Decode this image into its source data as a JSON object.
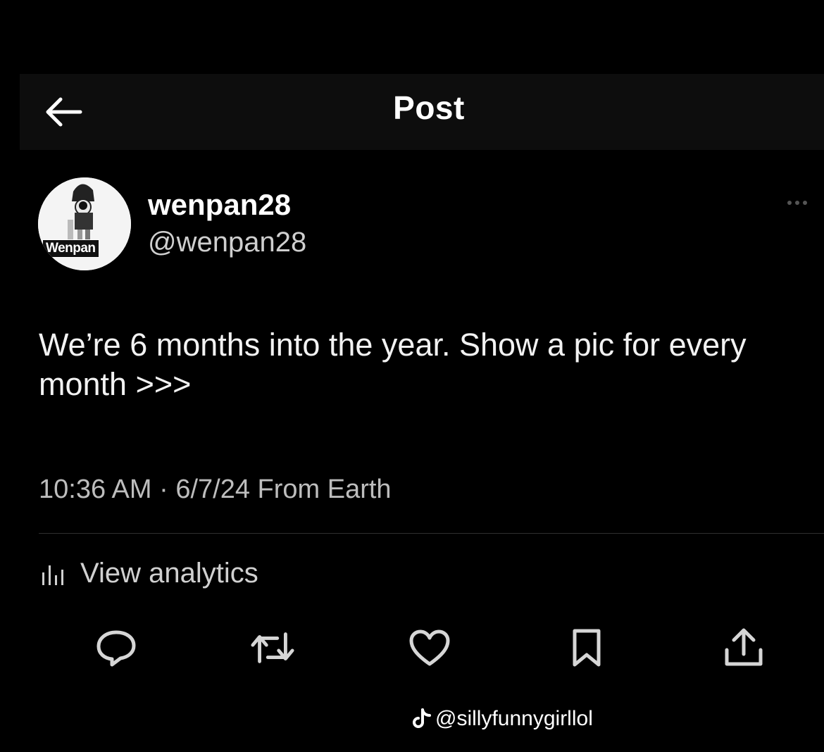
{
  "header": {
    "title": "Post"
  },
  "author": {
    "display_name": "wenpan28",
    "handle": "@wenpan28",
    "avatar_label": "Wenpan"
  },
  "post": {
    "text": "We’re 6 months into the year. Show a pic for every month >>>",
    "meta": "10:36 AM · 6/7/24 From Earth"
  },
  "analytics": {
    "label": "View analytics"
  },
  "actions": [
    "reply-icon",
    "repost-icon",
    "like-icon",
    "bookmark-icon",
    "share-icon"
  ],
  "watermark": {
    "text": "@sillyfunnygirllol"
  },
  "colors": {
    "background": "#000000",
    "header_bg": "#0d0d0d",
    "text": "#ffffff",
    "secondary_text": "#bdbdbd",
    "icon": "#d6d6d6"
  }
}
